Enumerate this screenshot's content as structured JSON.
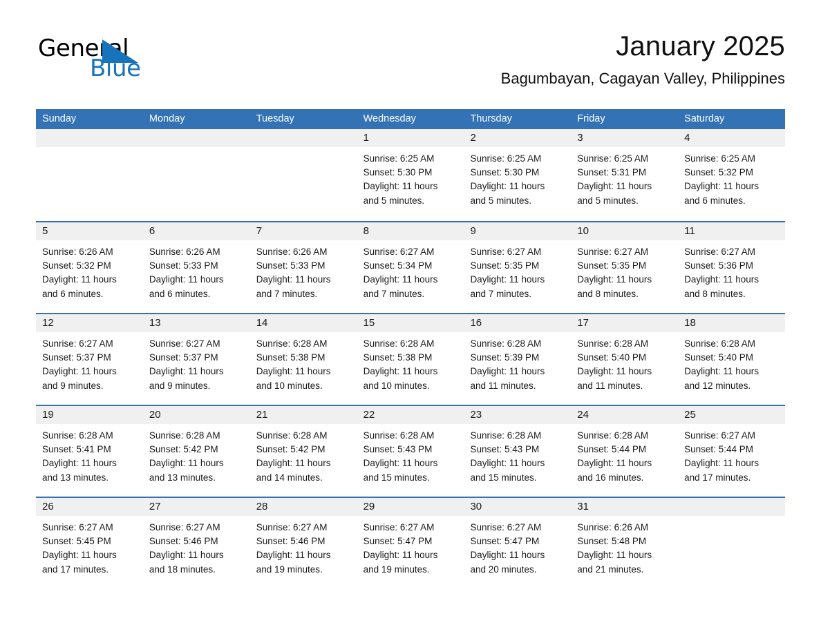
{
  "brand": {
    "name_part1": "General",
    "name_part2": "Blue",
    "triangle_icon": "brand-triangle-icon",
    "accent_color": "#1773bc"
  },
  "header": {
    "month_title": "January 2025",
    "location": "Bagumbayan, Cagayan Valley, Philippines"
  },
  "theme": {
    "header_blue": "#3372b5",
    "day_band_gray": "#f0f0f0",
    "text_color": "#1a1a1a"
  },
  "calendar": {
    "weekdays": [
      "Sunday",
      "Monday",
      "Tuesday",
      "Wednesday",
      "Thursday",
      "Friday",
      "Saturday"
    ],
    "weeks": [
      [
        {
          "day": "",
          "lines": []
        },
        {
          "day": "",
          "lines": []
        },
        {
          "day": "",
          "lines": []
        },
        {
          "day": "1",
          "lines": [
            "Sunrise: 6:25 AM",
            "Sunset: 5:30 PM",
            "Daylight: 11 hours",
            "and 5 minutes."
          ]
        },
        {
          "day": "2",
          "lines": [
            "Sunrise: 6:25 AM",
            "Sunset: 5:30 PM",
            "Daylight: 11 hours",
            "and 5 minutes."
          ]
        },
        {
          "day": "3",
          "lines": [
            "Sunrise: 6:25 AM",
            "Sunset: 5:31 PM",
            "Daylight: 11 hours",
            "and 5 minutes."
          ]
        },
        {
          "day": "4",
          "lines": [
            "Sunrise: 6:25 AM",
            "Sunset: 5:32 PM",
            "Daylight: 11 hours",
            "and 6 minutes."
          ]
        }
      ],
      [
        {
          "day": "5",
          "lines": [
            "Sunrise: 6:26 AM",
            "Sunset: 5:32 PM",
            "Daylight: 11 hours",
            "and 6 minutes."
          ]
        },
        {
          "day": "6",
          "lines": [
            "Sunrise: 6:26 AM",
            "Sunset: 5:33 PM",
            "Daylight: 11 hours",
            "and 6 minutes."
          ]
        },
        {
          "day": "7",
          "lines": [
            "Sunrise: 6:26 AM",
            "Sunset: 5:33 PM",
            "Daylight: 11 hours",
            "and 7 minutes."
          ]
        },
        {
          "day": "8",
          "lines": [
            "Sunrise: 6:27 AM",
            "Sunset: 5:34 PM",
            "Daylight: 11 hours",
            "and 7 minutes."
          ]
        },
        {
          "day": "9",
          "lines": [
            "Sunrise: 6:27 AM",
            "Sunset: 5:35 PM",
            "Daylight: 11 hours",
            "and 7 minutes."
          ]
        },
        {
          "day": "10",
          "lines": [
            "Sunrise: 6:27 AM",
            "Sunset: 5:35 PM",
            "Daylight: 11 hours",
            "and 8 minutes."
          ]
        },
        {
          "day": "11",
          "lines": [
            "Sunrise: 6:27 AM",
            "Sunset: 5:36 PM",
            "Daylight: 11 hours",
            "and 8 minutes."
          ]
        }
      ],
      [
        {
          "day": "12",
          "lines": [
            "Sunrise: 6:27 AM",
            "Sunset: 5:37 PM",
            "Daylight: 11 hours",
            "and 9 minutes."
          ]
        },
        {
          "day": "13",
          "lines": [
            "Sunrise: 6:27 AM",
            "Sunset: 5:37 PM",
            "Daylight: 11 hours",
            "and 9 minutes."
          ]
        },
        {
          "day": "14",
          "lines": [
            "Sunrise: 6:28 AM",
            "Sunset: 5:38 PM",
            "Daylight: 11 hours",
            "and 10 minutes."
          ]
        },
        {
          "day": "15",
          "lines": [
            "Sunrise: 6:28 AM",
            "Sunset: 5:38 PM",
            "Daylight: 11 hours",
            "and 10 minutes."
          ]
        },
        {
          "day": "16",
          "lines": [
            "Sunrise: 6:28 AM",
            "Sunset: 5:39 PM",
            "Daylight: 11 hours",
            "and 11 minutes."
          ]
        },
        {
          "day": "17",
          "lines": [
            "Sunrise: 6:28 AM",
            "Sunset: 5:40 PM",
            "Daylight: 11 hours",
            "and 11 minutes."
          ]
        },
        {
          "day": "18",
          "lines": [
            "Sunrise: 6:28 AM",
            "Sunset: 5:40 PM",
            "Daylight: 11 hours",
            "and 12 minutes."
          ]
        }
      ],
      [
        {
          "day": "19",
          "lines": [
            "Sunrise: 6:28 AM",
            "Sunset: 5:41 PM",
            "Daylight: 11 hours",
            "and 13 minutes."
          ]
        },
        {
          "day": "20",
          "lines": [
            "Sunrise: 6:28 AM",
            "Sunset: 5:42 PM",
            "Daylight: 11 hours",
            "and 13 minutes."
          ]
        },
        {
          "day": "21",
          "lines": [
            "Sunrise: 6:28 AM",
            "Sunset: 5:42 PM",
            "Daylight: 11 hours",
            "and 14 minutes."
          ]
        },
        {
          "day": "22",
          "lines": [
            "Sunrise: 6:28 AM",
            "Sunset: 5:43 PM",
            "Daylight: 11 hours",
            "and 15 minutes."
          ]
        },
        {
          "day": "23",
          "lines": [
            "Sunrise: 6:28 AM",
            "Sunset: 5:43 PM",
            "Daylight: 11 hours",
            "and 15 minutes."
          ]
        },
        {
          "day": "24",
          "lines": [
            "Sunrise: 6:28 AM",
            "Sunset: 5:44 PM",
            "Daylight: 11 hours",
            "and 16 minutes."
          ]
        },
        {
          "day": "25",
          "lines": [
            "Sunrise: 6:27 AM",
            "Sunset: 5:44 PM",
            "Daylight: 11 hours",
            "and 17 minutes."
          ]
        }
      ],
      [
        {
          "day": "26",
          "lines": [
            "Sunrise: 6:27 AM",
            "Sunset: 5:45 PM",
            "Daylight: 11 hours",
            "and 17 minutes."
          ]
        },
        {
          "day": "27",
          "lines": [
            "Sunrise: 6:27 AM",
            "Sunset: 5:46 PM",
            "Daylight: 11 hours",
            "and 18 minutes."
          ]
        },
        {
          "day": "28",
          "lines": [
            "Sunrise: 6:27 AM",
            "Sunset: 5:46 PM",
            "Daylight: 11 hours",
            "and 19 minutes."
          ]
        },
        {
          "day": "29",
          "lines": [
            "Sunrise: 6:27 AM",
            "Sunset: 5:47 PM",
            "Daylight: 11 hours",
            "and 19 minutes."
          ]
        },
        {
          "day": "30",
          "lines": [
            "Sunrise: 6:27 AM",
            "Sunset: 5:47 PM",
            "Daylight: 11 hours",
            "and 20 minutes."
          ]
        },
        {
          "day": "31",
          "lines": [
            "Sunrise: 6:26 AM",
            "Sunset: 5:48 PM",
            "Daylight: 11 hours",
            "and 21 minutes."
          ]
        },
        {
          "day": "",
          "lines": []
        }
      ]
    ]
  }
}
